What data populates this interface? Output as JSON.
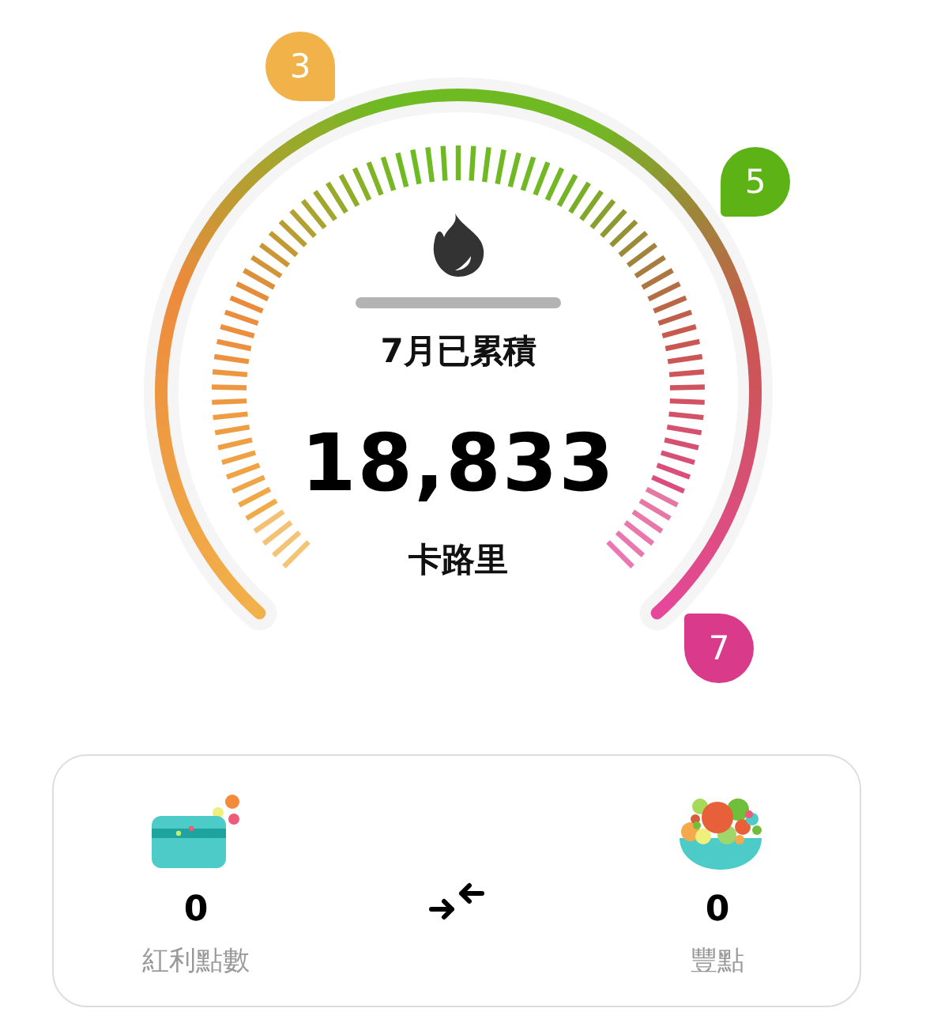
{
  "gauge": {
    "title": "7月已累積",
    "value": "18,833",
    "unit": "卡路里"
  },
  "badges": [
    {
      "label": "3",
      "color": "#f2b24a"
    },
    {
      "label": "5",
      "color": "#5db316"
    },
    {
      "label": "7",
      "color": "#d93a8a"
    }
  ],
  "points": [
    {
      "kind": "card",
      "value": "0",
      "label": "紅利點數"
    },
    {
      "kind": "bowl",
      "value": "0",
      "label": "豐點"
    }
  ]
}
